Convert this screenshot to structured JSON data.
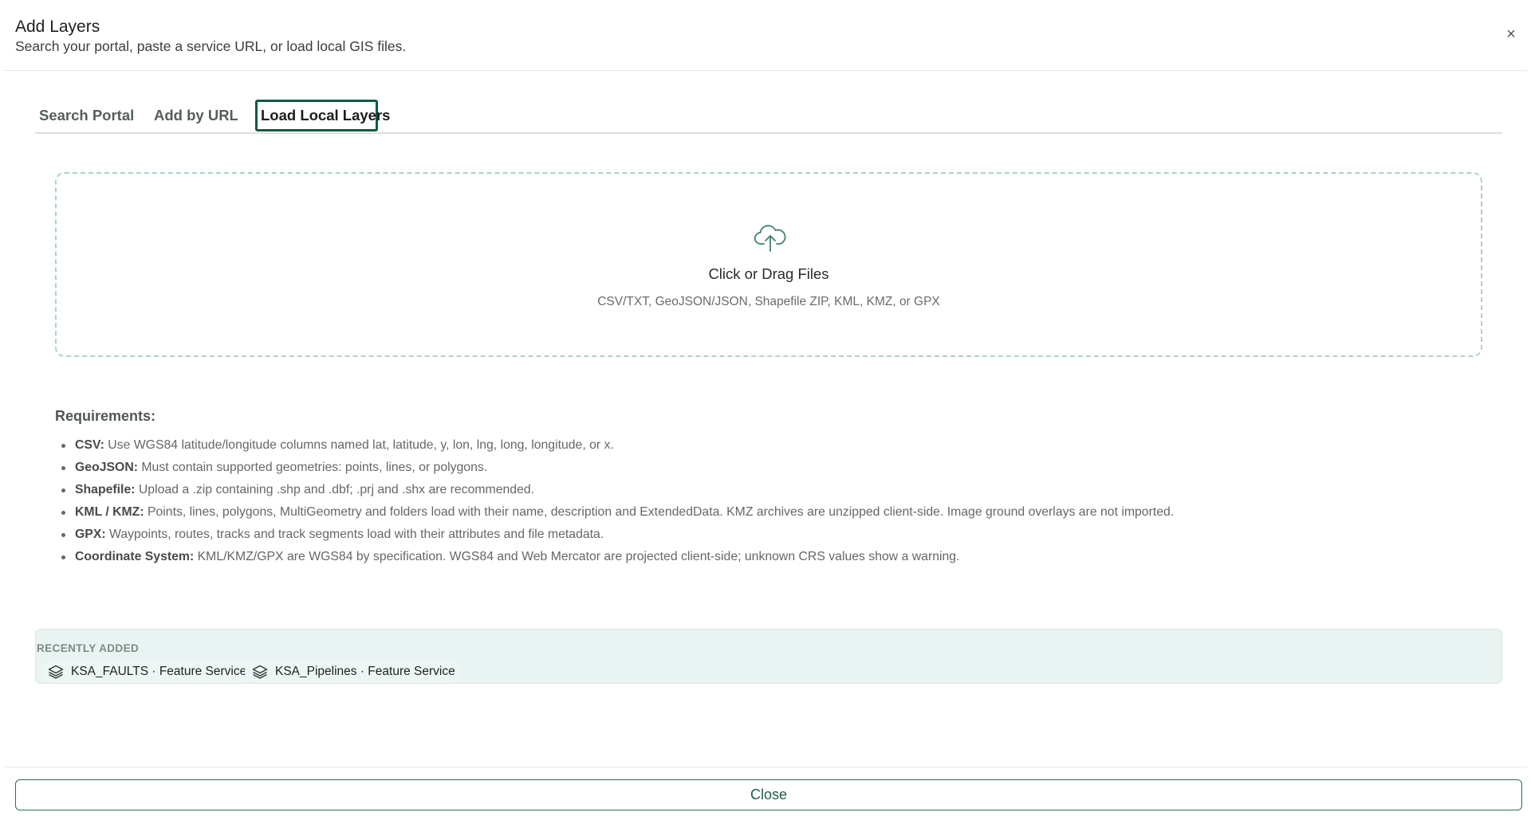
{
  "dialog": {
    "title": "Add Layers",
    "subtitle": "Search your portal, paste a service URL, or load local GIS files.",
    "close_icon": "×"
  },
  "tabs": [
    {
      "label": "Search Portal",
      "active": false
    },
    {
      "label": "Add by URL",
      "active": false
    },
    {
      "label": "Load Local Layers",
      "active": true
    }
  ],
  "dropzone": {
    "icon": "cloud-upload-icon",
    "title": "Click or Drag Files",
    "formats": "CSV/TXT, GeoJSON/JSON, Shapefile ZIP, KML, KMZ, or GPX"
  },
  "requirements": {
    "title": "Requirements:",
    "items": [
      {
        "term": "CSV:",
        "text": "Use WGS84 latitude/longitude columns named lat, latitude, y, lon, lng, long, longitude, or x."
      },
      {
        "term": "GeoJSON:",
        "text": "Must contain supported geometries: points, lines, or polygons."
      },
      {
        "term": "Shapefile:",
        "text": "Upload a .zip containing .shp and .dbf; .prj and .shx are recommended."
      },
      {
        "term": "KML / KMZ:",
        "text": "Points, lines, polygons, MultiGeometry and folders load with their name, description and ExtendedData. KMZ archives are unzipped client-side. Image ground overlays are not imported."
      },
      {
        "term": "GPX:",
        "text": "Waypoints, routes, tracks and track segments load with their attributes and file metadata."
      },
      {
        "term": "Coordinate System:",
        "text": "KML/KMZ/GPX are WGS84 by specification. WGS84 and Web Mercator are projected client-side; unknown CRS values show a warning."
      }
    ]
  },
  "recent": {
    "label": "RECENTLY ADDED",
    "items": [
      {
        "label": "KSA_FAULTS · Feature Service",
        "icon": "layers-icon"
      },
      {
        "label": "KSA_Pipelines · Feature Service",
        "icon": "layers-icon"
      }
    ]
  },
  "footer": {
    "close_label": "Close"
  },
  "colors": {
    "accent": "#0e5a45",
    "dropzone_border": "#a9d3c6",
    "recent_bg": "#e9f3f2"
  }
}
